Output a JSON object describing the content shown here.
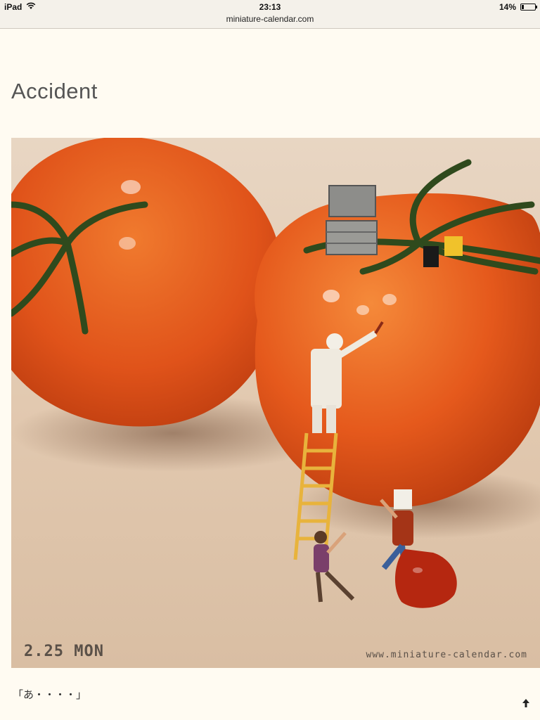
{
  "status_bar": {
    "device": "iPad",
    "time": "23:13",
    "battery_percent": "14%",
    "battery_level": 0.14
  },
  "browser": {
    "url": "miniature-calendar.com"
  },
  "post": {
    "title": "Accident",
    "photo": {
      "date_stamp": "2.25 MON",
      "watermark": "www.miniature-calendar.com"
    },
    "caption": "「あ・・・・」"
  },
  "icons": {
    "wifi": "wifi-icon",
    "battery": "battery-icon",
    "scroll_top": "arrow-up-icon"
  },
  "colors": {
    "page_background": "#fffbf2",
    "tomato": "#e5531a",
    "ketchup": "#b52710"
  }
}
